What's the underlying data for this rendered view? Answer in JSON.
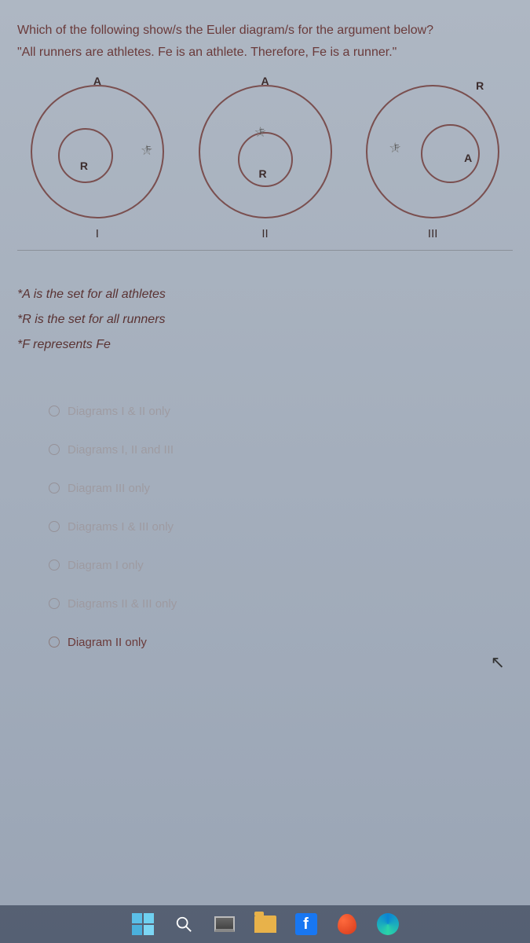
{
  "question": {
    "line1": "Which of the following show/s the Euler diagram/s for the argument below?",
    "line2": "\"All runners are athletes. Fe is an athlete. Therefore, Fe is a runner.\""
  },
  "diagrams": {
    "d1": {
      "outer": "A",
      "inner": "R",
      "star": "F",
      "roman": "I"
    },
    "d2": {
      "outer": "A",
      "inner": "R",
      "star": "F",
      "roman": "II"
    },
    "d3": {
      "outer": "R",
      "inner": "A",
      "star": "F",
      "roman": "III"
    }
  },
  "legend": {
    "a": "*A is the set for all athletes",
    "r": "*R is the set for all runners",
    "f": "*F represents Fe"
  },
  "options": [
    {
      "label": "Diagrams I & II only"
    },
    {
      "label": "Diagrams I, II and III"
    },
    {
      "label": "Diagram III only"
    },
    {
      "label": "Diagrams I & III only"
    },
    {
      "label": "Diagram I only"
    },
    {
      "label": "Diagrams II & III only"
    },
    {
      "label": "Diagram II only"
    }
  ],
  "taskbar": {
    "start": "start-menu",
    "search": "search",
    "taskview": "task-view",
    "files": "file-explorer",
    "fb": "f",
    "app": "app",
    "edge": "edge"
  }
}
